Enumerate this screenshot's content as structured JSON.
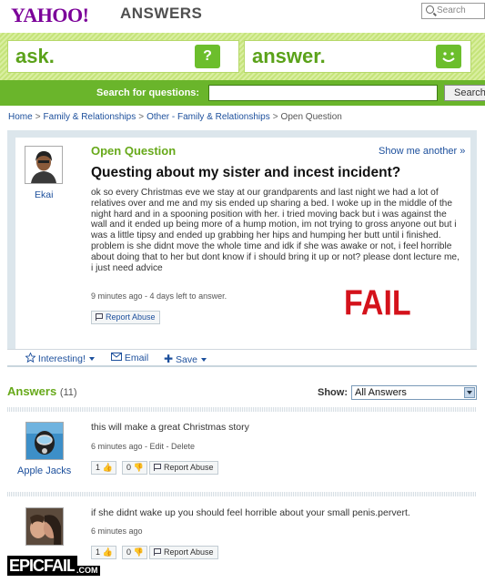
{
  "header": {
    "logo": "YAHOO!",
    "section": "ANSWERS",
    "search_placeholder": "Search"
  },
  "band": {
    "ask_label": "ask.",
    "ask_icon": "?",
    "answer_label": "answer.",
    "answer_icon": "smiley-icon"
  },
  "search_bar": {
    "label": "Search for questions:",
    "button": "Search"
  },
  "breadcrumb": [
    "Home",
    "Family & Relationships",
    "Other - Family & Relationships",
    "Open Question"
  ],
  "question": {
    "status": "Open Question",
    "show_another": "Show me another »",
    "asker": "Ekai",
    "title": "Questing about my sister and incest incident?",
    "body": "ok so every Christmas eve we stay at our grandparents and last night we had a lot of relatives over and me and my sis ended up sharing a bed. I woke up in the middle of the night hard and in a spooning position with her. i tried moving back but i was against the wall and it ended up being more of a hump motion, im not trying to gross anyone out but i was a little tipsy and ended up grabbing her hips and humping her butt until i finished. problem is she didnt move the whole time and idk if she was awake or not, i feel horrible about doing that to her but dont know if i should bring it up or not? please dont lecture me, i just need advice",
    "time": "9 minutes ago - 4 days left to answer.",
    "report": "Report Abuse",
    "overlay_text": "FAIL"
  },
  "question_actions": {
    "interesting": "Interesting!",
    "email": "Email",
    "save": "Save"
  },
  "answers": {
    "title": "Answers",
    "count": "(11)",
    "show_label": "Show:",
    "show_value": "All Answers",
    "items": [
      {
        "user": "Apple Jacks",
        "text": "this will make a great Christmas story",
        "meta": "6 minutes ago - Edit - Delete",
        "thumbs_up": "1",
        "thumbs_down": "0",
        "report": "Report Abuse"
      },
      {
        "user": "",
        "text": "if she didnt wake up you should feel horrible about your small penis.pervert.",
        "meta": "6 minutes ago",
        "thumbs_up": "1",
        "thumbs_down": "0",
        "report": "Report Abuse"
      }
    ]
  },
  "watermark": {
    "main": "EPICFAIL",
    "suffix": ".COM"
  },
  "colors": {
    "yahoo_purple": "#7b0099",
    "green": "#67a91a",
    "link_blue": "#1c4f9c",
    "fail_red": "#d4121b"
  }
}
